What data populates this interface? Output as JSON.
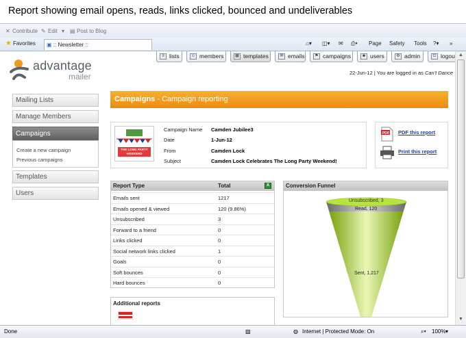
{
  "caption": "Report showing email opens, reads, links clicked, bounced and undeliverables",
  "browser": {
    "contribute": "Contribute",
    "edit": "Edit",
    "post_to_blog": "Post to Blog",
    "favorites": "Favorites",
    "tab_title": ":: Newsletter ::",
    "menu_page": "Page",
    "menu_safety": "Safety",
    "menu_tools": "Tools",
    "status_done": "Done",
    "status_zone": "Internet | Protected Mode: On",
    "zoom": "100%"
  },
  "app": {
    "logo_name": "advantage",
    "logo_sub": "mailer",
    "date": "22-Jun-12",
    "login_prefix": " | You are logged in as ",
    "user": "Can't Dance",
    "nav": [
      {
        "label": "lists"
      },
      {
        "label": "members"
      },
      {
        "label": "templates"
      },
      {
        "label": "emails"
      },
      {
        "label": "campaigns"
      },
      {
        "label": "users"
      },
      {
        "label": "admin"
      },
      {
        "label": "logout"
      }
    ],
    "sidebar": [
      {
        "label": "Mailing Lists"
      },
      {
        "label": "Manage Members"
      },
      {
        "label": "Campaigns"
      },
      {
        "label": "Templates"
      },
      {
        "label": "Users"
      }
    ],
    "sidebar_sub": [
      "Create a new campaign",
      "Previous campaigns"
    ]
  },
  "banner": {
    "title": "Campaigns",
    "subtitle": " - Campaign reporting"
  },
  "campaign": {
    "thumb_text": "THE LONG PARTY WEEKEND",
    "fields": [
      {
        "label": "Campaign Name",
        "value": "Camden Jubilee3"
      },
      {
        "label": "Date",
        "value": "1-Jun-12"
      },
      {
        "label": "From",
        "value": "Camden Lock"
      },
      {
        "label": "Subject",
        "value": "Camden Lock Celebrates The Long Party Weekend!"
      }
    ],
    "pdf_label": "PDF this report",
    "print_label": "Print this report"
  },
  "report": {
    "col_type": "Report Type",
    "col_total": "Total",
    "rows": [
      {
        "k": "Emails sent",
        "v": "1217"
      },
      {
        "k": "Emails opened & viewed",
        "v": "120 (9.86%)"
      },
      {
        "k": "Unsubscribed",
        "v": "3"
      },
      {
        "k": "Forward to a friend",
        "v": "0"
      },
      {
        "k": "Links clicked",
        "v": "0"
      },
      {
        "k": "Social network links clicked",
        "v": "1"
      },
      {
        "k": "Goals",
        "v": "0"
      },
      {
        "k": "Soft bounces",
        "v": "0"
      },
      {
        "k": "Hard bounces",
        "v": "0"
      }
    ]
  },
  "funnel": {
    "title": "Conversion Funnel",
    "stages": [
      {
        "label": "Unsubscribed, 3"
      },
      {
        "label": "Read, 120"
      },
      {
        "label": "Sent, 1,217"
      }
    ]
  },
  "additional": {
    "title": "Additional reports"
  }
}
